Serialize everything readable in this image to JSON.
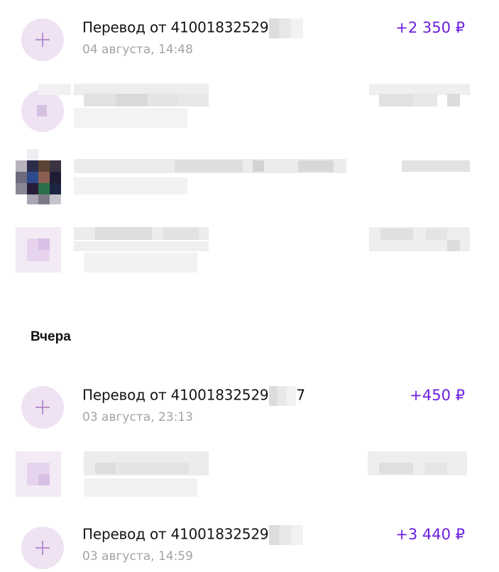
{
  "colors": {
    "accent": "#6b1fe0",
    "avatar_bg": "#eee2f3",
    "avatar_plus": "#b98fcc",
    "secondary_text": "#a3a3a3"
  },
  "transactions_today": [
    {
      "icon": "plus-icon",
      "title": "Перевод от 41001832529",
      "date": "04 августа, 14:48",
      "amount": "+2 350 ₽"
    }
  ],
  "section_yesterday": {
    "title": "Вчера"
  },
  "transactions_yesterday": [
    {
      "icon": "plus-icon",
      "title": "Перевод от 41001832529",
      "title_suffix": "7",
      "date": "03 августа, 23:13",
      "amount": "+450 ₽"
    },
    {
      "icon": "plus-icon",
      "title": "Перевод от 41001832529",
      "date": "03 августа, 14:59",
      "amount": "+3 440 ₽"
    }
  ]
}
